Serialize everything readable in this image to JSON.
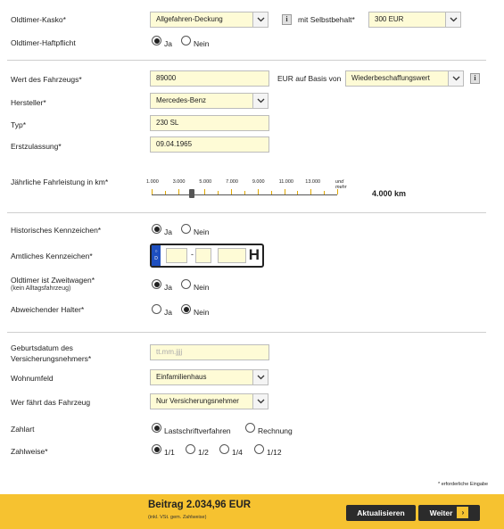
{
  "kasko": {
    "label": "Oldtimer-Kasko*",
    "value": "Allgefahren-Deckung",
    "selbstbehalt_label": "mit Selbstbehalt*",
    "selbstbehalt_value": "300 EUR"
  },
  "haftpflicht": {
    "label": "Oldtimer-Haftpflicht",
    "yes": "Ja",
    "no": "Nein",
    "selected": "yes"
  },
  "fahrzeugwert": {
    "label": "Wert des Fahrzeugs*",
    "value": "89000",
    "basis_label": "EUR auf Basis von",
    "basis_value": "Wiederbeschaffungswert"
  },
  "hersteller": {
    "label": "Hersteller*",
    "value": "Mercedes-Benz"
  },
  "typ": {
    "label": "Typ*",
    "value": "230 SL"
  },
  "erstzulassung": {
    "label": "Erstzulassung*",
    "value": "09.04.1965"
  },
  "fahrleistung": {
    "label": "Jährliche Fahrleistung in km*",
    "ticks": [
      "1.000",
      "3.000",
      "5.000",
      "7.000",
      "9.000",
      "11.000",
      "13.000"
    ],
    "tick_more": "und mehr",
    "value_text": "4.000 km",
    "value": 4000,
    "min": 1000,
    "max": 15000
  },
  "historisch": {
    "label": "Historisches Kennzeichen*",
    "yes": "Ja",
    "no": "Nein",
    "selected": "yes"
  },
  "amtlich": {
    "label": "Amtliches Kennzeichen*",
    "plate_country": "D",
    "plate_suffix": "H",
    "dash": "-"
  },
  "zweitwagen": {
    "label": "Oldtimer ist Zweitwagen*",
    "sublabel": "(kein Alltagsfahrzeug)",
    "yes": "Ja",
    "no": "Nein",
    "selected": "yes"
  },
  "halter": {
    "label": "Abweichender Halter*",
    "yes": "Ja",
    "no": "Nein",
    "selected": "no"
  },
  "geburtsdatum": {
    "label_line1": "Geburtsdatum des",
    "label_line2": "Versicherungsnehmers*",
    "placeholder": "tt.mm.jjjj"
  },
  "wohnumfeld": {
    "label": "Wohnumfeld",
    "value": "Einfamilienhaus"
  },
  "fahrer": {
    "label": "Wer fährt das Fahrzeug",
    "value": "Nur Versicherungsnehmer"
  },
  "zahlart": {
    "label": "Zahlart",
    "option1": "Lastschriftverfahren",
    "option2": "Rechnung",
    "selected": "option1"
  },
  "zahlweise": {
    "label": "Zahlweise*",
    "options": [
      "1/1",
      "1/2",
      "1/4",
      "1/12"
    ],
    "selected": 0
  },
  "required_note": "* erforderliche Eingabe",
  "footer": {
    "beitrag": "Beitrag 2.034,96 EUR",
    "beitrag_note": "(inkl. VSt. gem. Zahlweise)",
    "update_label": "Aktualisieren",
    "next_label": "Weiter"
  },
  "icons": {
    "info": "info-icon",
    "dropdown": "chevron-down-icon",
    "next": "chevron-right-icon"
  },
  "colors": {
    "footer": "#f6c230",
    "field_bg": "#fefbd6",
    "button": "#2b2b2b",
    "plate_eu": "#1e4fbf"
  }
}
